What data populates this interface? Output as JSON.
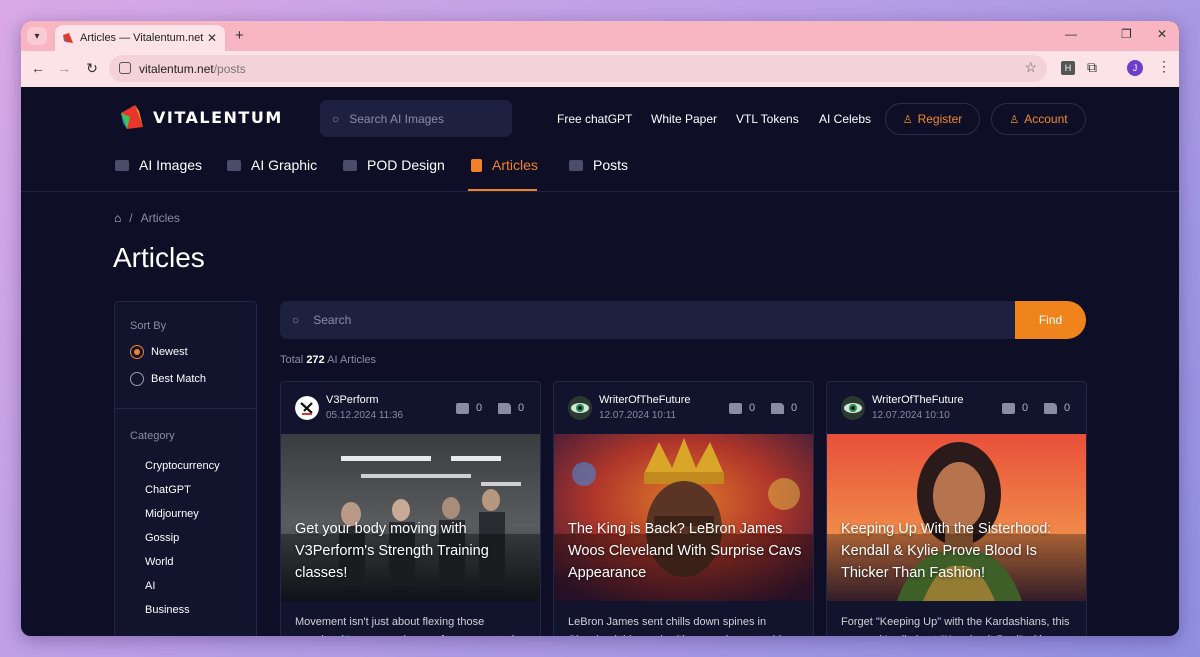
{
  "browser": {
    "tab_title": "Articles — Vitalentum.net",
    "url_host": "vitalentum.net",
    "url_path": "/posts",
    "profile_initial": "J",
    "ext_h_label": "H"
  },
  "header": {
    "logo_text": "VITALENTUM",
    "search_placeholder": "Search AI Images",
    "links": [
      "Free chatGPT",
      "White Paper",
      "VTL Tokens",
      "AI Celebs"
    ],
    "register_label": "Register",
    "account_label": "Account"
  },
  "categories_nav": [
    {
      "label": "AI Images",
      "active": false
    },
    {
      "label": "AI Graphic",
      "active": false
    },
    {
      "label": "POD Design",
      "active": false
    },
    {
      "label": "Articles",
      "active": true
    },
    {
      "label": "Posts",
      "active": false
    }
  ],
  "breadcrumb": {
    "separator": "/",
    "current": "Articles"
  },
  "page_title": "Articles",
  "sidebar": {
    "sort_label": "Sort By",
    "sort_options": [
      {
        "label": "Newest",
        "selected": true
      },
      {
        "label": "Best Match",
        "selected": false
      }
    ],
    "category_label": "Category",
    "categories": [
      "Cryptocurrency",
      "ChatGPT",
      "Midjourney",
      "Gossip",
      "World",
      "AI",
      "Business"
    ]
  },
  "search": {
    "placeholder": "Search",
    "button_label": "Find"
  },
  "total": {
    "prefix": "Total",
    "count": "272",
    "suffix": "AI Articles"
  },
  "colors": {
    "accent": "#f0841c",
    "background": "#0e0f26",
    "panel": "#12132c"
  },
  "articles": [
    {
      "author": "V3Perform",
      "date": "05.12.2024 11:36",
      "comments": "0",
      "likes": "0",
      "title": "Get your body moving with V3Perform's Strength Training classes!",
      "excerpt": "Movement isn't just about flexing those muscles, it's a game-changer for your mental"
    },
    {
      "author": "WriterOfTheFuture",
      "date": "12.07.2024 10:11",
      "comments": "0",
      "likes": "0",
      "title": "The King is Back? LeBron James Woos Cleveland With Surprise Cavs Appearance",
      "excerpt": "LeBron James sent chills down spines in Cleveland this week with a surprise courtside"
    },
    {
      "author": "WriterOfTheFuture",
      "date": "12.07.2024 10:10",
      "comments": "0",
      "likes": "0",
      "title": "Keeping Up With the Sisterhood: Kendall & Kylie Prove Blood Is Thicker Than Fashion!",
      "excerpt": "Forget \"Keeping Up\" with the Kardashians, this season it's all about \"Keeping it Real\" with"
    }
  ]
}
